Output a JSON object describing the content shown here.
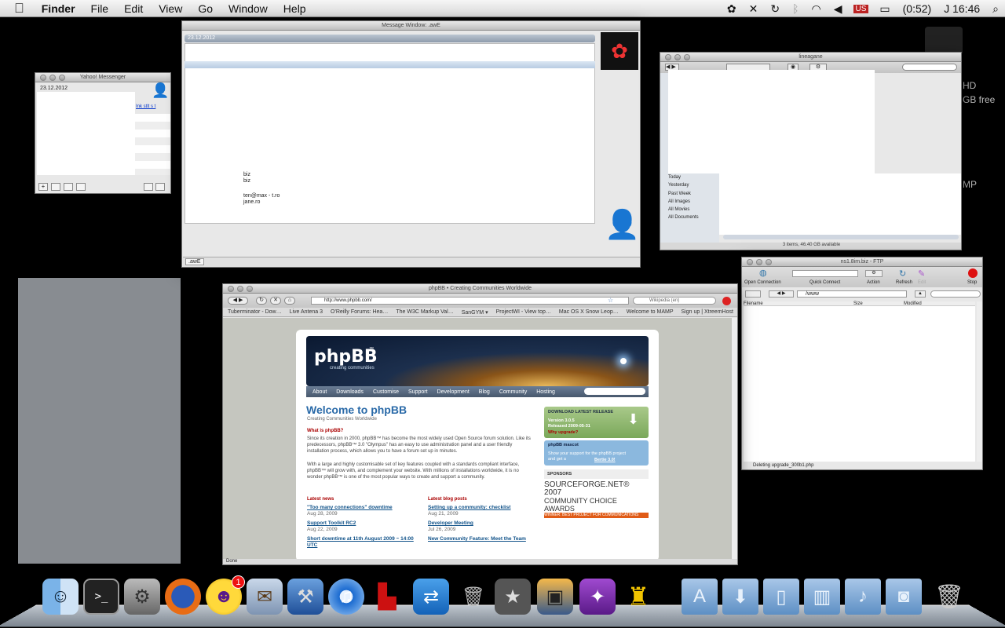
{
  "menubar": {
    "apple": "",
    "items": [
      "Finder",
      "File",
      "Edit",
      "View",
      "Go",
      "Window",
      "Help"
    ],
    "extras": {
      "battery": "(0:52)",
      "clock": "J 16:46"
    }
  },
  "yahoo": {
    "title": "Yahoo! Messenger",
    "date": "23.12.2012",
    "link": "Ink stlt s t"
  },
  "message": {
    "title": "Message Window: .awE",
    "date": "23.12.2012",
    "lines": [
      "biz",
      "biz",
      "ten@max - t.ro",
      "jane.ro"
    ],
    "footer": ".awE"
  },
  "finder": {
    "title": "lineagane",
    "sidebar": [
      "Today",
      "Yesterday",
      "Past Week",
      "All Images",
      "All Movies",
      "All Documents"
    ],
    "status": "3 items, 46.40 GB available"
  },
  "ftp": {
    "title": "ns1.8im.biz - FTP",
    "toolbar": [
      "Open Connection",
      "Quick Connect",
      "Action",
      "Refresh",
      "Edit",
      "Stop"
    ],
    "path": "/www",
    "columns": [
      "Filename",
      "Size",
      "Modified"
    ],
    "status": "Deleting upgrade_300b1.php"
  },
  "desktop": {
    "disk_label": "HD",
    "free": "GB free",
    "mp": "MP"
  },
  "browser": {
    "title": "phpBB • Creating Communities Worldwide",
    "url": "http://www.phpbb.com/",
    "search": "Wikipedia (en)",
    "bookmarks": [
      "Tuberminator - Dow…",
      "Live Antena 3",
      "O'Reilly Forums: Hea…",
      "The W3C Markup Val…",
      "SanGYM ▾",
      "ProjectWI - View top…",
      "Mac OS X Snow Leop…",
      "Welcome to MAMP",
      "Sign up | XtreemHost"
    ],
    "status": "Done",
    "page": {
      "logo": "phpBB",
      "logo_tm": "™",
      "tagline": "creating communities",
      "nav": [
        "About",
        "Downloads",
        "Customise",
        "Support",
        "Development",
        "Blog",
        "Community",
        "Hosting"
      ],
      "welcome": "Welcome to phpBB",
      "welcome_sub": "Creating Communities Worldwide",
      "what_heading": "What is phpBB?",
      "para1": "Since its creation in 2000, phpBB™ has become the most widely used Open Source forum solution. Like its predecessors, phpBB™ 3.0 \"Olympus\" has an easy to use administration panel and a user friendly installation process, which allows you to have a forum set up in minutes.",
      "para2": "With a large and highly customisable set of key features coupled with a standards compliant interface, phpBB™ will grow with, and complement your website. With millions of installations worldwide, it is no wonder phpBB™ is one of the most popular ways to create and support a community.",
      "news_heading": "Latest news",
      "news": [
        {
          "title": "\"Too many connections\" downtime",
          "date": "Aug 28, 2009"
        },
        {
          "title": "Support Toolkit RC2",
          "date": "Aug 22, 2009"
        },
        {
          "title": "Short downtime at 11th August 2009 ~ 14:00 UTC",
          "date": ""
        }
      ],
      "blog_heading": "Latest blog posts",
      "blog": [
        {
          "title": "Setting up a community: checklist",
          "date": "Aug 21, 2009"
        },
        {
          "title": "Developer Meeting",
          "date": "Jul 26, 2009"
        },
        {
          "title": "New Community Feature: Meet the Team",
          "date": ""
        }
      ],
      "download": {
        "heading": "DOWNLOAD LATEST RELEASE",
        "version": "Version 3.0.5",
        "released": "Released 2009-05-31",
        "upgrade": "Why upgrade?"
      },
      "mascot": {
        "heading": "phpBB mascot",
        "text": "Show your support for the phpBB project and get a",
        "link": "Bertie 3.0!"
      },
      "sponsors": "SPONSORS",
      "sf_line1": "SOURCEFORGE.NET® 2007",
      "sf_line2": "COMMUNITY CHOICE AWARDS",
      "sf_line3": "WINNER: BEST PROJECT FOR COMMUNICATIONS"
    }
  },
  "dock": {
    "badge": "1",
    "icons": [
      "finder-icon",
      "terminal-icon",
      "system-preferences-icon",
      "firefox-icon",
      "yahoo-messenger-icon",
      "mail-icon",
      "xcode-icon",
      "itunes-icon",
      "front-row-icon",
      "teamviewer-icon",
      "utilities-icon",
      "imovie-icon",
      "iphoto-icon",
      "photo-editor-icon",
      "cyberduck-icon"
    ],
    "folders": [
      "applications-folder",
      "downloads-folder",
      "documents-folder",
      "movies-folder",
      "music-folder",
      "pictures-folder"
    ],
    "trash": "trash-icon"
  }
}
